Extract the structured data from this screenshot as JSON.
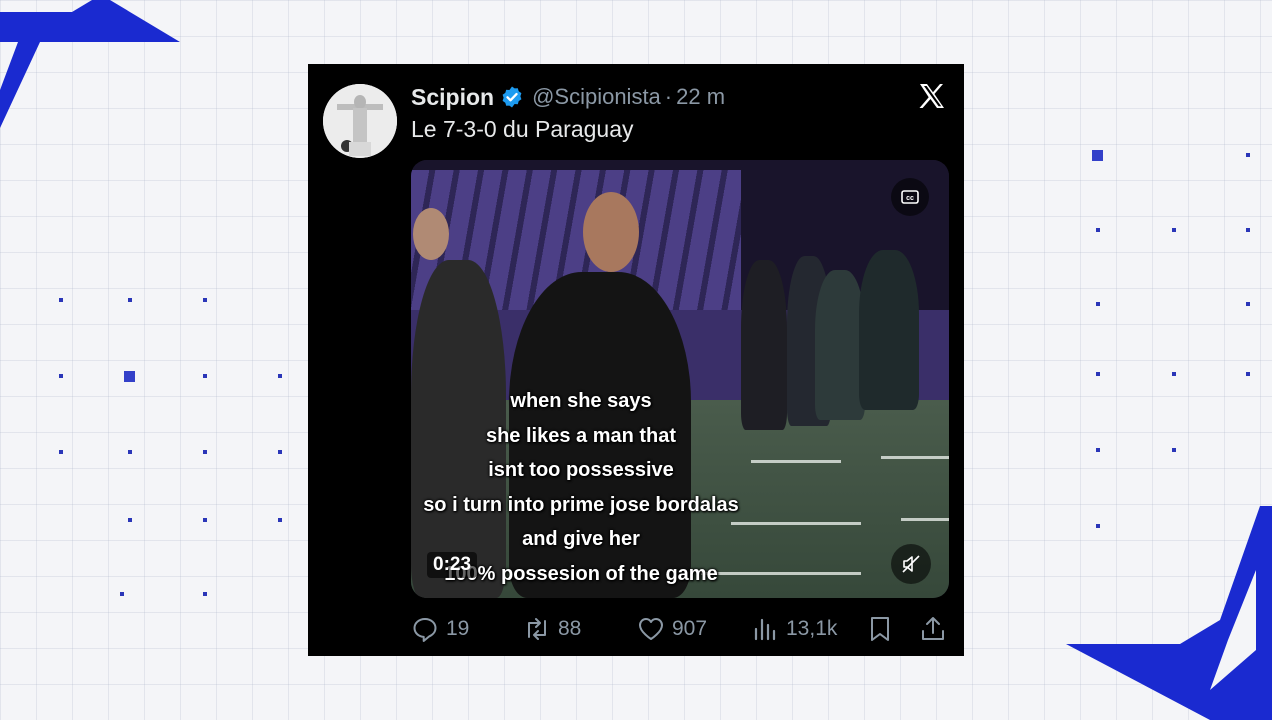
{
  "tweet": {
    "display_name": "Scipion",
    "handle": "@Scipionista",
    "separator": "·",
    "time": "22 m",
    "text": "Le 7-3-0 du Paraguay",
    "verified": true,
    "accent_color": "#1d9bf0"
  },
  "video": {
    "duration": "0:23",
    "caption_lines": [
      "when she says",
      "she likes a man that",
      "isnt too possessive",
      "so i turn into prime jose bordalas",
      "and give her",
      "100% possesion of the game"
    ]
  },
  "actions": {
    "replies": "19",
    "reposts": "88",
    "likes": "907",
    "views": "13,1k"
  },
  "icons": [
    "verified-badge-icon",
    "x-logo-icon",
    "closed-captions-icon",
    "muted-speaker-icon",
    "reply-icon",
    "repost-icon",
    "like-icon",
    "views-icon",
    "bookmark-icon",
    "share-icon"
  ],
  "colors": {
    "brand_blue": "#1a2ad0",
    "tweet_bg": "#000000",
    "muted_text": "#8b98a5"
  }
}
